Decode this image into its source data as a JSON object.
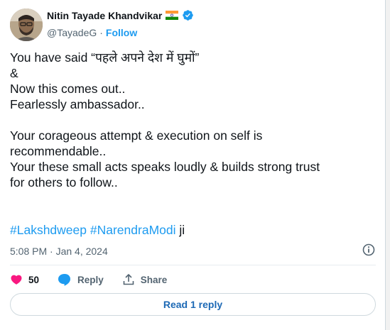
{
  "author": {
    "name": "Nitin Tayade Khandvikar",
    "handle": "@TayadeG",
    "separator": "·",
    "follow_label": "Follow"
  },
  "tweet": {
    "lines": [
      "You have said “पहले अपने देश में घुमों”",
      "&",
      "Now this comes out..",
      "Fearlessly ambassador..",
      "",
      "Your corageous attempt & execution on self is",
      "recommendable..",
      "Your these small acts speaks loudly & builds strong trust",
      "for others to follow.."
    ],
    "hashtags": [
      "#Lakshdweep",
      "#NarendraModi"
    ],
    "trailing_text": "ji",
    "timestamp": "5:08 PM · Jan 4, 2024"
  },
  "actions": {
    "like_count": "50",
    "reply_label": "Reply",
    "share_label": "Share"
  },
  "read_replies_label": "Read 1 reply",
  "colors": {
    "accent": "#1d9bf0",
    "like": "#f91880",
    "verified": "#1d9bf0",
    "text": "#0f1419",
    "muted": "#536471"
  },
  "icons": [
    "india-flag-icon",
    "verified-badge-icon",
    "info-icon",
    "heart-icon",
    "reply-bubble-icon",
    "share-icon"
  ]
}
